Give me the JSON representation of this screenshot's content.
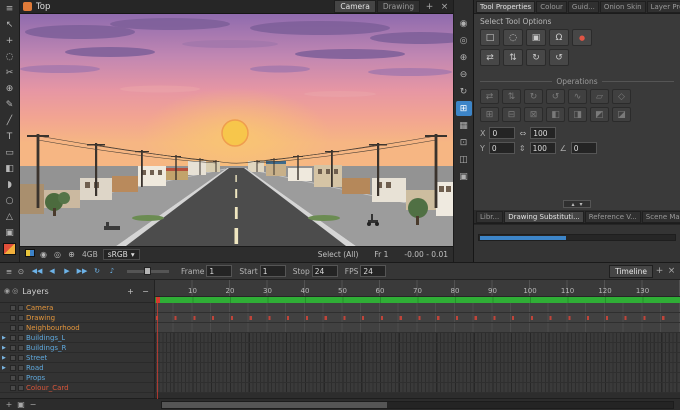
{
  "colors": {
    "accent_blue": "#3d85c8",
    "timeline_green": "#2fae36",
    "playhead_red": "#d43b2f",
    "layer_orange": "#e2953c",
    "layer_blue": "#5fa8dc",
    "layer_red": "#d8553a"
  },
  "viewport": {
    "title": "Top",
    "tabs": [
      {
        "label": "Camera",
        "state": "active"
      },
      {
        "label": "Drawing"
      }
    ],
    "add_tab": "+",
    "close_tab": "×"
  },
  "left_toolbar": {
    "tools": [
      {
        "name": "menu",
        "glyph": "≡"
      },
      {
        "name": "select",
        "glyph": "↖"
      },
      {
        "name": "transform",
        "glyph": "+"
      },
      {
        "name": "lasso",
        "glyph": "◌"
      },
      {
        "name": "cutter",
        "glyph": "✂"
      },
      {
        "name": "reposition",
        "glyph": "⊕"
      },
      {
        "name": "brush",
        "glyph": "✎"
      },
      {
        "name": "pencil",
        "glyph": "╱"
      },
      {
        "name": "text",
        "glyph": "T"
      },
      {
        "name": "eraser",
        "glyph": "▭"
      },
      {
        "name": "paint",
        "glyph": "◧"
      },
      {
        "name": "dropper",
        "glyph": "◗"
      },
      {
        "name": "ellipse",
        "glyph": "○"
      },
      {
        "name": "polyline",
        "glyph": "△"
      },
      {
        "name": "shape",
        "glyph": "▣"
      },
      {
        "name": "colour-swatch",
        "glyph": "",
        "state": "chip"
      }
    ]
  },
  "view_strip": {
    "tools": [
      {
        "name": "reset-view",
        "glyph": "◉"
      },
      {
        "name": "camera-view",
        "glyph": "◎"
      },
      {
        "name": "zoom-in",
        "glyph": "⊕"
      },
      {
        "name": "zoom-out",
        "glyph": "⊖"
      },
      {
        "name": "rotate-view",
        "glyph": "↻"
      },
      {
        "name": "show-grid",
        "glyph": "⊞",
        "state": "accent"
      },
      {
        "name": "checker-background",
        "glyph": "▦"
      },
      {
        "name": "safe-area",
        "glyph": "⊡"
      },
      {
        "name": "split-view",
        "glyph": "◫"
      },
      {
        "name": "snapshot",
        "glyph": "▣"
      }
    ]
  },
  "status_bar": {
    "icons": [
      {
        "name": "colour-preview",
        "glyph": "",
        "state": "chip2"
      },
      {
        "name": "render-mode",
        "glyph": "◉"
      },
      {
        "name": "matte-mode",
        "glyph": "◎"
      },
      {
        "name": "zoom-indicator",
        "glyph": "⊕"
      }
    ],
    "memory": "4GB",
    "color_space": "sRGB",
    "dropdown_arrow": "▾",
    "selection": "Select (All)",
    "frame": "Fr 1",
    "coords": "-0.00 - 0.01"
  },
  "tool_panel": {
    "tabs": [
      {
        "label": "Tool Properties",
        "state": "active"
      },
      {
        "label": "Colour"
      },
      {
        "label": "Guid..."
      },
      {
        "label": "Onion Skin"
      },
      {
        "label": "Layer Properties"
      }
    ],
    "add_tab": "+",
    "close_tab": "×",
    "select_tool_options_label": "Select Tool Options",
    "operations_label": "Operations",
    "option_buttons": [
      {
        "name": "marquee",
        "glyph": "□"
      },
      {
        "name": "lasso",
        "glyph": "◌"
      },
      {
        "name": "select-by-colour",
        "glyph": "▣"
      },
      {
        "name": "snap-options",
        "glyph": "Ω"
      },
      {
        "name": "permanent-selection",
        "glyph": "●",
        "state": "red"
      }
    ],
    "option_buttons_row2": [
      {
        "name": "flip-horizontal",
        "glyph": "⇄"
      },
      {
        "name": "flip-vertical",
        "glyph": "⇅"
      },
      {
        "name": "rotate-90-cw",
        "glyph": "↻"
      },
      {
        "name": "rotate-90-ccw",
        "glyph": "↺"
      }
    ],
    "operation_buttons": [
      {
        "name": "op-flip-horizontal",
        "glyph": "⇄"
      },
      {
        "name": "op-flip-vertical",
        "glyph": "⇅"
      },
      {
        "name": "op-rotate-cw",
        "glyph": "↻"
      },
      {
        "name": "op-rotate-ccw",
        "glyph": "↺"
      },
      {
        "name": "op-smooth",
        "glyph": "∿"
      },
      {
        "name": "op-flatten",
        "glyph": "▱"
      },
      {
        "name": "op-distribute",
        "glyph": "◇"
      }
    ],
    "operation_buttons_row2": [
      {
        "name": "op-group",
        "glyph": "⊞"
      },
      {
        "name": "op-ungroup",
        "glyph": "⊟"
      },
      {
        "name": "op-merge",
        "glyph": "⊠"
      },
      {
        "name": "op-align-left",
        "glyph": "◧"
      },
      {
        "name": "op-align-right",
        "glyph": "◨"
      },
      {
        "name": "op-align-top",
        "glyph": "◩"
      },
      {
        "name": "op-align-bottom",
        "glyph": "◪"
      }
    ],
    "fields": {
      "x_label": "X",
      "x_value": "0",
      "y_label": "Y",
      "y_value": "0",
      "width_icon": "⇔",
      "width_value": "100",
      "height_icon": "⇕",
      "height_value": "100",
      "angle_icon": "∠",
      "angle_value": "0"
    },
    "collapse_up": "▴",
    "collapse_down": "▾"
  },
  "lower_panel": {
    "tabs": [
      {
        "label": "Libr..."
      },
      {
        "label": "Drawing Substituti...",
        "state": "active"
      },
      {
        "label": "Reference V..."
      },
      {
        "label": "Scene Mark..."
      }
    ],
    "add_tab": "+",
    "close_tab": "×"
  },
  "timeline": {
    "title": "Timeline",
    "add_tab": "+",
    "close_tab": "×",
    "lead_icons": [
      {
        "name": "timeline-menu",
        "glyph": "≡"
      },
      {
        "name": "timeline-options",
        "glyph": "⊙"
      }
    ],
    "transport": [
      {
        "name": "first-frame",
        "glyph": "◀◀"
      },
      {
        "name": "prev-frame",
        "glyph": "◀"
      },
      {
        "name": "play",
        "glyph": "▶"
      },
      {
        "name": "last-frame",
        "glyph": "▶▶"
      },
      {
        "name": "loop",
        "glyph": "↻"
      },
      {
        "name": "sound",
        "glyph": "♪"
      }
    ],
    "frame_label": "Frame",
    "frame_value": "1",
    "start_label": "Start",
    "start_value": "1",
    "stop_label": "Stop",
    "stop_value": "24",
    "fps_label": "FPS",
    "fps_value": "24",
    "layers_header": "Layers",
    "header_icons": [
      {
        "name": "show-all-layers",
        "glyph": "◉"
      },
      {
        "name": "solo-mode",
        "glyph": "◎"
      }
    ],
    "add_layer": "+",
    "remove_layer": "−",
    "ruler": [
      "10",
      "20",
      "30",
      "40",
      "50",
      "60",
      "70",
      "80",
      "90",
      "100",
      "110",
      "120",
      "130"
    ],
    "layers": [
      {
        "label": "Camera",
        "color": "#e2953c",
        "arrow": "",
        "track": "sparse"
      },
      {
        "label": "Drawing",
        "color": "#e2953c",
        "arrow": "",
        "track": "marks"
      },
      {
        "label": "Neighbourhood",
        "color": "#e2953c",
        "arrow": "",
        "track": "sparse"
      },
      {
        "label": "Buildings_L",
        "color": "#5fa8dc",
        "arrow": "▶",
        "track": "dense"
      },
      {
        "label": "Buildings_R",
        "color": "#5fa8dc",
        "arrow": "▶",
        "track": "dense"
      },
      {
        "label": "Street",
        "color": "#5fa8dc",
        "arrow": "▶",
        "track": "dense"
      },
      {
        "label": "Road",
        "color": "#5fa8dc",
        "arrow": "▶",
        "track": "dense"
      },
      {
        "label": "Props",
        "color": "#5fa8dc",
        "arrow": "",
        "track": "dense"
      },
      {
        "label": "Colour_Card",
        "color": "#d8553a",
        "arrow": "",
        "track": "dense"
      }
    ],
    "bottom_icons": [
      {
        "name": "add-drawing-layer",
        "glyph": "+"
      },
      {
        "name": "add-peg",
        "glyph": "▣"
      },
      {
        "name": "delete-layer",
        "glyph": "−"
      }
    ]
  }
}
